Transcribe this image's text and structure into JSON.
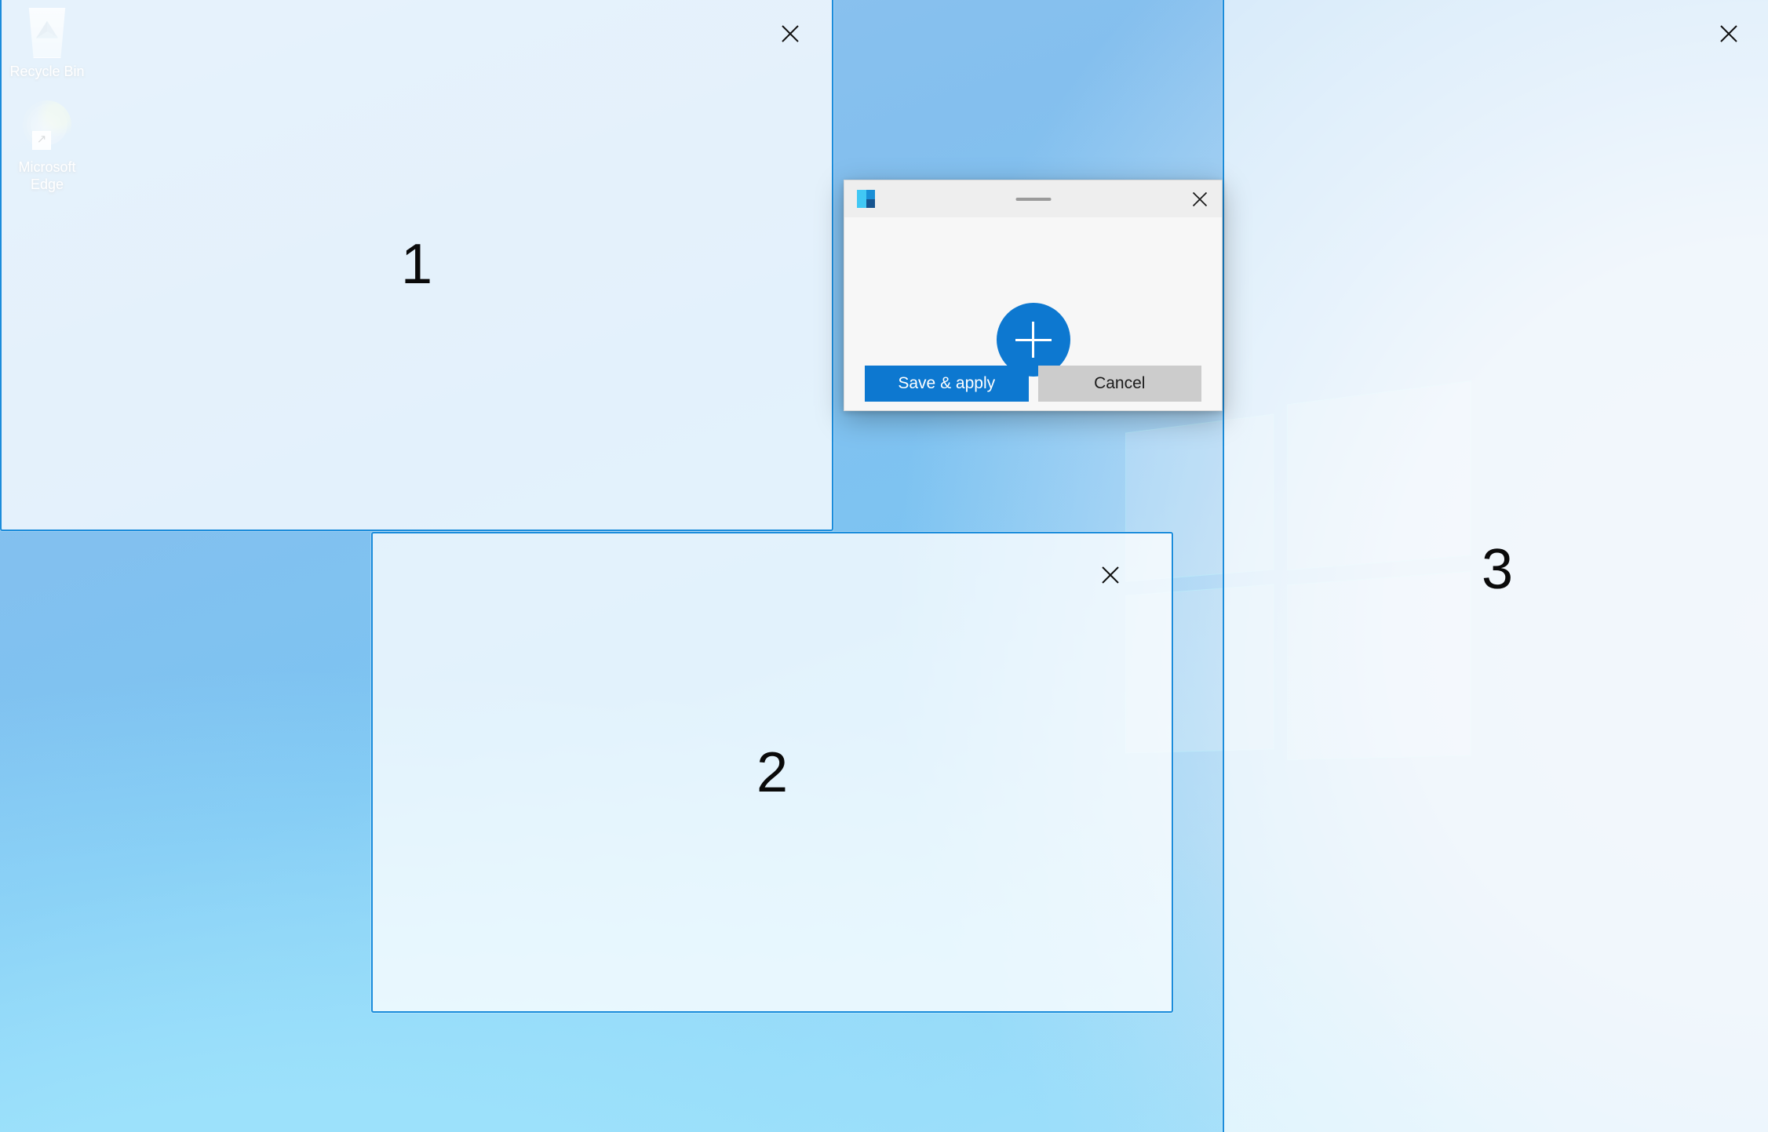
{
  "desktop": {
    "icons": [
      {
        "name": "recycle-bin",
        "label": "Recycle Bin"
      },
      {
        "name": "microsoft-edge",
        "label": "Microsoft Edge"
      }
    ],
    "wallpaper_colors": {
      "top": "#8fc4ef",
      "mid": "#7cc4f2",
      "bottom_left": "#9ce1fb",
      "right_light": "#dbe8f7"
    }
  },
  "zone_editor": {
    "zone_border_color": "#1b8cdb",
    "zones": [
      {
        "id": "zone-1",
        "number": "1",
        "close_label": "Close zone 1"
      },
      {
        "id": "zone-2",
        "number": "2",
        "close_label": "Close zone 2"
      },
      {
        "id": "zone-3",
        "number": "3",
        "close_label": "Close zone 3"
      }
    ]
  },
  "dialog": {
    "app_icon": "fancyzones-icon",
    "drag_handle": "window-drag-handle",
    "close_icon": "close-icon",
    "add_zone_icon": "plus-icon",
    "add_zone_label": "Add zone",
    "primary_button": "Save & apply",
    "secondary_button": "Cancel",
    "accent_color": "#0d78d0",
    "secondary_color": "#cccccc"
  }
}
